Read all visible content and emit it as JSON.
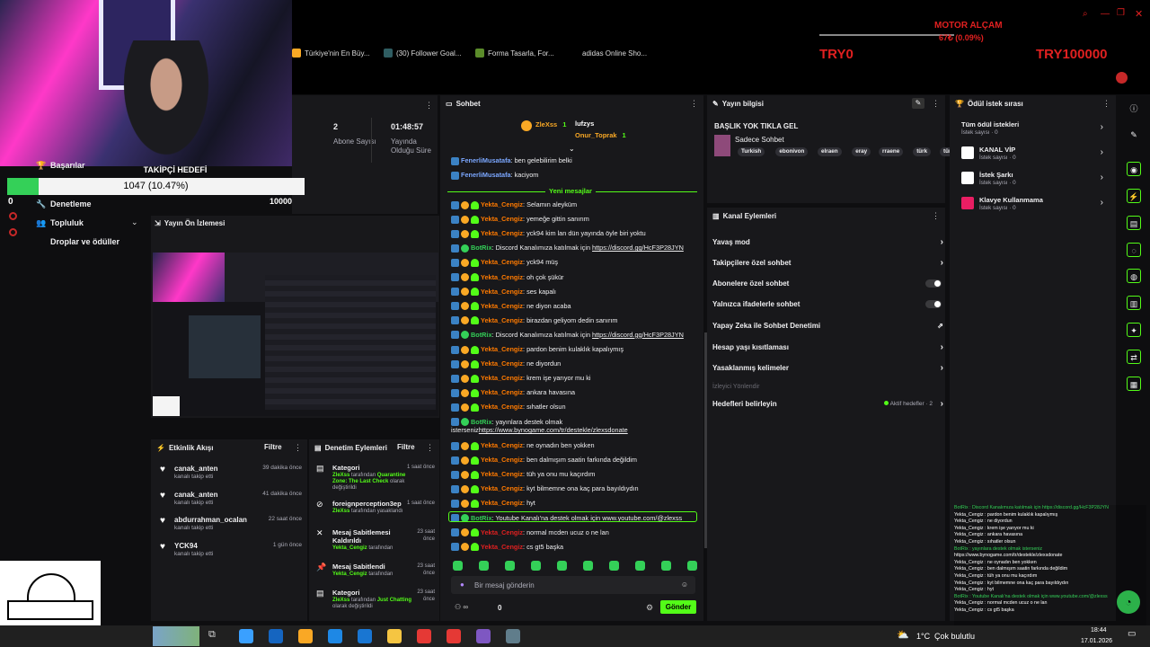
{
  "bookmarks": [
    {
      "label": "Türkiye'nin En Büy...",
      "color": "#f9a825"
    },
    {
      "label": "(30) Follower Goal...",
      "color": "#2f5d62"
    },
    {
      "label": "Forma Tasarla, For...",
      "color": "#5b8c2a"
    },
    {
      "label": "adidas Online Sho...",
      "color": "#000000"
    }
  ],
  "overlay": {
    "motor_title": "MOTOR ALÇAM",
    "motor_sub": "67₺ (0.09%)",
    "try_left": "TRY0",
    "try_right": "TRY100000"
  },
  "goal": {
    "title": "TAKİPÇİ HEDEFİ",
    "text": "1047 (10.47%)",
    "fraction": 0.1047,
    "max": "10000"
  },
  "nav": {
    "achievements": "Başarılar",
    "moderation": "Denetleme",
    "community": "Topluluk",
    "drops": "Droplar ve ödüller",
    "zero": "0"
  },
  "stats": {
    "subs_value": "2",
    "subs_label": "Abone Sayısı",
    "time_value": "01:48:57",
    "time_label": "Yayında Olduğu Süre"
  },
  "preview": {
    "title": "Yayın Ön İzlemesi"
  },
  "activity": {
    "title": "Etkinlik Akışı",
    "filter": "Filtre",
    "items": [
      {
        "name": "canak_anten",
        "sub": "kanalı takip etti",
        "time": "39 dakika önce"
      },
      {
        "name": "canak_anten",
        "sub": "kanalı takip etti",
        "time": "41 dakika önce"
      },
      {
        "name": "abdurrahman_ocalan",
        "sub": "kanalı takip etti",
        "time": "22 saat önce"
      },
      {
        "name": "YCK94",
        "sub": "kanalı takip etti",
        "time": "1 gün önce"
      }
    ]
  },
  "modlog": {
    "title": "Denetim Eylemleri",
    "filter": "Filtre",
    "items": [
      {
        "title": "Kategori",
        "time": "1 saat önce",
        "pre": "ZleXss",
        "mid": " tarafından ",
        "hl": "Quarantine Zone: The Last Check",
        "post": " olarak değiştirildi"
      },
      {
        "title": "foreignperception3ep",
        "time": "1 saat önce",
        "pre": "ZleXss",
        "mid": " tarafından yasaklandı",
        "hl": "",
        "post": ""
      },
      {
        "title": "Mesaj Sabitlemesi Kaldırıldı",
        "time": "23 saat önce",
        "pre": "Yekta_Cengiz",
        "mid": " tarafından",
        "hl": "",
        "post": ""
      },
      {
        "title": "Mesaj Sabitlendi",
        "time": "23 saat önce",
        "pre": "Yekta_Cengiz",
        "mid": " tarafından",
        "hl": "",
        "post": ""
      },
      {
        "title": "Kategori",
        "time": "23 saat önce",
        "pre": "ZleXss",
        "mid": " tarafından ",
        "hl": "Just Chatting",
        "post": " olarak değiştirildi"
      }
    ]
  },
  "chat": {
    "title": "Sohbet",
    "top_users": [
      {
        "name": "ZleXss",
        "count": "1"
      },
      {
        "name": "lufzys",
        "count": ""
      },
      {
        "name": "Onur_Toprak",
        "count": "1"
      }
    ],
    "old": [
      {
        "user": "FenerliMusatafa",
        "text": ": ben gelebilirim belki"
      },
      {
        "user": "FenerliMusatafa",
        "text": ": kaciyom"
      }
    ],
    "new_label": "Yeni mesajlar",
    "messages": [
      {
        "user": "Yekta_Cengiz",
        "text": ": Selamın aleyküm",
        "bot": false,
        "link": ""
      },
      {
        "user": "Yekta_Cengiz",
        "text": ": yemeğe gittin sanırım",
        "bot": false,
        "link": ""
      },
      {
        "user": "Yekta_Cengiz",
        "text": ": yck94 kim lan dün yayında öyle biri yoktu",
        "bot": false,
        "link": ""
      },
      {
        "user": "BotRix",
        "text": ": Discord Kanalımıza katılmak için ",
        "bot": true,
        "link": "https://discord.gg/HcF3P28JYN"
      },
      {
        "user": "Yekta_Cengiz",
        "text": ": yck94 müş",
        "bot": false,
        "link": ""
      },
      {
        "user": "Yekta_Cengiz",
        "text": ": oh çok şükür",
        "bot": false,
        "link": ""
      },
      {
        "user": "Yekta_Cengiz",
        "text": ": ses kapalı",
        "bot": false,
        "link": ""
      },
      {
        "user": "Yekta_Cengiz",
        "text": ": ne diyon acaba",
        "bot": false,
        "link": ""
      },
      {
        "user": "Yekta_Cengiz",
        "text": ": birazdan geliyom dedin sanırım",
        "bot": false,
        "link": ""
      },
      {
        "user": "BotRix",
        "text": ": Discord Kanalımıza katılmak için ",
        "bot": true,
        "link": "https://discord.gg/HcF3P28JYN"
      },
      {
        "user": "Yekta_Cengiz",
        "text": ": pardon benim kulaklık kapalıymış",
        "bot": false,
        "link": ""
      },
      {
        "user": "Yekta_Cengiz",
        "text": ": ne diyordun",
        "bot": false,
        "link": ""
      },
      {
        "user": "Yekta_Cengiz",
        "text": ": krem işe yarıyor mu ki",
        "bot": false,
        "link": ""
      },
      {
        "user": "Yekta_Cengiz",
        "text": ": ankara havasına",
        "bot": false,
        "link": ""
      },
      {
        "user": "Yekta_Cengiz",
        "text": ": sıhatler olsun",
        "bot": false,
        "link": ""
      },
      {
        "user": "BotRix",
        "text": ": yayınlara destek olmak isterseniz",
        "bot": true,
        "link": "https://www.bynogame.com/tr/destekle/zlexsdonate"
      },
      {
        "user": "Yekta_Cengiz",
        "text": ": ne oynadın ben yokken",
        "bot": false,
        "link": ""
      },
      {
        "user": "Yekta_Cengiz",
        "text": ": ben dalmışım saatin farkında değildim",
        "bot": false,
        "link": ""
      },
      {
        "user": "Yekta_Cengiz",
        "text": ": tüh ya onu mu kaçırdım",
        "bot": false,
        "link": ""
      },
      {
        "user": "Yekta_Cengiz",
        "text": ": kyt bilmemne ona kaç para bayıldıydın",
        "bot": false,
        "link": ""
      },
      {
        "user": "Yekta_Cengiz",
        "text": ": hyt",
        "bot": false,
        "link": ""
      },
      {
        "user": "BotRix",
        "text": ": Youtube Kanalı'na destek olmak için www.youtube.com/@zlexss",
        "bot": true,
        "link": ""
      },
      {
        "user": "Yekta_Cengiz",
        "text": ": normal mcden ucuz o ne lan",
        "bot": false,
        "link": ""
      },
      {
        "user": "Yekta_Cengiz",
        "text": ": cs gt5 başka",
        "bot": false,
        "link": ""
      }
    ],
    "placeholder": "Bir mesaj gönderin",
    "points": "0",
    "send": "Gönder"
  },
  "stream_info": {
    "title": "Yayın bilgisi",
    "headline": "BAŞLIK YOK TIKLA GEL",
    "category": "Sadece Sohbet",
    "tags": [
      "Turkish",
      "ebonivon",
      "elraen",
      "eray",
      "rraene",
      "türk",
      "türkiye"
    ]
  },
  "channel_actions": {
    "title": "Kanal Eylemleri",
    "items": [
      {
        "label": "Yavaş mod",
        "kind": "chev",
        "muted": false
      },
      {
        "label": "Takipçilere özel sohbet",
        "kind": "chev",
        "muted": false
      },
      {
        "label": "Abonelere özel sohbet",
        "kind": "toggle",
        "muted": false
      },
      {
        "label": "Yalnızca ifadelerle sohbet",
        "kind": "toggle",
        "muted": false
      },
      {
        "label": "Yapay Zeka ile Sohbet Denetimi",
        "kind": "ext",
        "muted": false
      },
      {
        "label": "Hesap yaşı kısıtlaması",
        "kind": "chev",
        "muted": false
      },
      {
        "label": "Yasaklanmış kelimeler",
        "kind": "chev",
        "muted": false
      },
      {
        "label": "İzleyici Yönlendir",
        "kind": "none",
        "muted": true
      },
      {
        "label": "Hedefleri belirleyin",
        "kind": "goal",
        "muted": false
      }
    ],
    "active_goals": "Aktif hedefler · 2"
  },
  "rewards": {
    "title": "Ödül istek sırası",
    "all": "Tüm ödül istekleri",
    "all_count": "İstek sayısı · 0",
    "items": [
      {
        "title": "KANAL VİP",
        "sub": "İstek sayısı · 0",
        "color": "#ffffff"
      },
      {
        "title": "İstek Şarkı",
        "sub": "İstek sayısı · 0",
        "color": "#ffffff"
      },
      {
        "title": "Klavye Kullanmama",
        "sub": "İstek sayısı · 0",
        "color": "#e91e63"
      }
    ]
  },
  "mini_chat": [
    "BotRix : Discord Kanalımıza katılmak için https://discord.gg/HcF3P28JYN",
    "Yekta_Cengiz : pardon benim kulaklık kapalıymış",
    "Yekta_Cengiz : ne diyordun",
    "Yekta_Cengiz : krem işe yarıyor mu ki",
    "Yekta_Cengiz : ankara havasına",
    "Yekta_Cengiz : sıhatler olsun",
    "BotRix : yayınlara destek olmak isterseniz",
    "https://www.bynogame.com/tr/destekle/zlexsdonate",
    "Yekta_Cengiz : ne oynadın ben yokken",
    "Yekta_Cengiz : ben dalmışım saatin farkında değildim",
    "Yekta_Cengiz : tüh ya onu mu kaçırdım",
    "Yekta_Cengiz : kyt bilmemne ona kaç para bayıldıydın",
    "Yekta_Cengiz : hyt",
    "BotRix : Youtube Kanalı'na destek olmak için www.youtube.com/@zlexss",
    "Yekta_Cengiz : normal mcden ucuz o ne lan",
    "Yekta_Cengiz : cs gt5 başka"
  ],
  "taskbar": {
    "temp": "1°C",
    "weather": "Çok bulutlu",
    "time": "18:44",
    "date": "17.01.2026"
  },
  "colors": {
    "accent": "#53fc18",
    "bg": "#18181b",
    "user": "#ff7a00",
    "bot": "#34d058"
  }
}
